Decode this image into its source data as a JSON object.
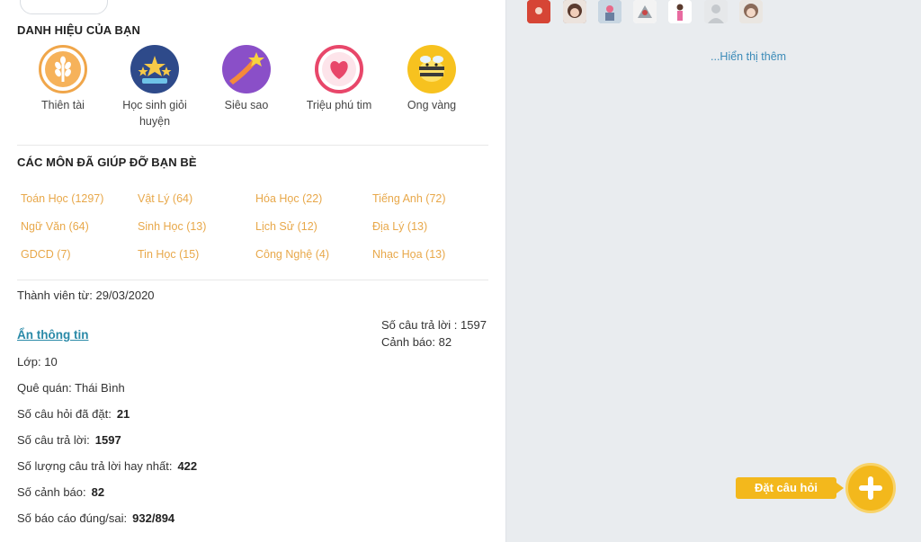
{
  "colors": {
    "accent": "#f3b81c",
    "subject": "#e8a84a",
    "link": "#2a8aa8",
    "panel": "#e9ecef"
  },
  "titles_section": {
    "title": "DANH HIỆU CỦA BẠN",
    "badges": [
      {
        "label": "Thiên tài",
        "icon": "wheat-icon"
      },
      {
        "label": "Học sinh giỏi huyện",
        "icon": "stars-trophy-icon"
      },
      {
        "label": "Siêu sao",
        "icon": "shooting-star-icon"
      },
      {
        "label": "Triệu phú tim",
        "icon": "heart-icon"
      },
      {
        "label": "Ong vàng",
        "icon": "bee-icon"
      }
    ]
  },
  "subjects_section": {
    "title": "CÁC MÔN ĐÃ GIÚP ĐỠ BẠN BÈ",
    "items": [
      "Toán Học (1297)",
      "Vật Lý (64)",
      "Hóa Học (22)",
      "Tiếng Anh (72)",
      "Ngữ Văn (64)",
      "Sinh Học (13)",
      "Lịch Sử (12)",
      "Địa Lý (13)",
      "GDCD (7)",
      "Tin Học (15)",
      "Công Nghệ (4)",
      "Nhạc Họa (13)"
    ]
  },
  "profile": {
    "member_since": "Thành viên từ: 29/03/2020",
    "answers_count_line": "Số câu trả lời : 1597",
    "warnings_line": "Cảnh báo: 82",
    "hide_info_link": "Ẩn thông tin",
    "details": [
      {
        "label": "Lớp: 10",
        "value": ""
      },
      {
        "label": "Quê quán: Thái Bình",
        "value": ""
      },
      {
        "label": "Số câu hỏi đã đặt:",
        "value": "21"
      },
      {
        "label": "Số câu trả lời:",
        "value": "1597"
      },
      {
        "label": "Số lượng câu trả lời hay nhất:",
        "value": "422"
      },
      {
        "label": "Số cảnh báo:",
        "value": "82"
      },
      {
        "label": "Số báo cáo đúng/sai:",
        "value": "932/894"
      }
    ]
  },
  "sidebar": {
    "show_more": "...Hiển thị thêm",
    "ask_button": "Đặt câu hỏi"
  }
}
